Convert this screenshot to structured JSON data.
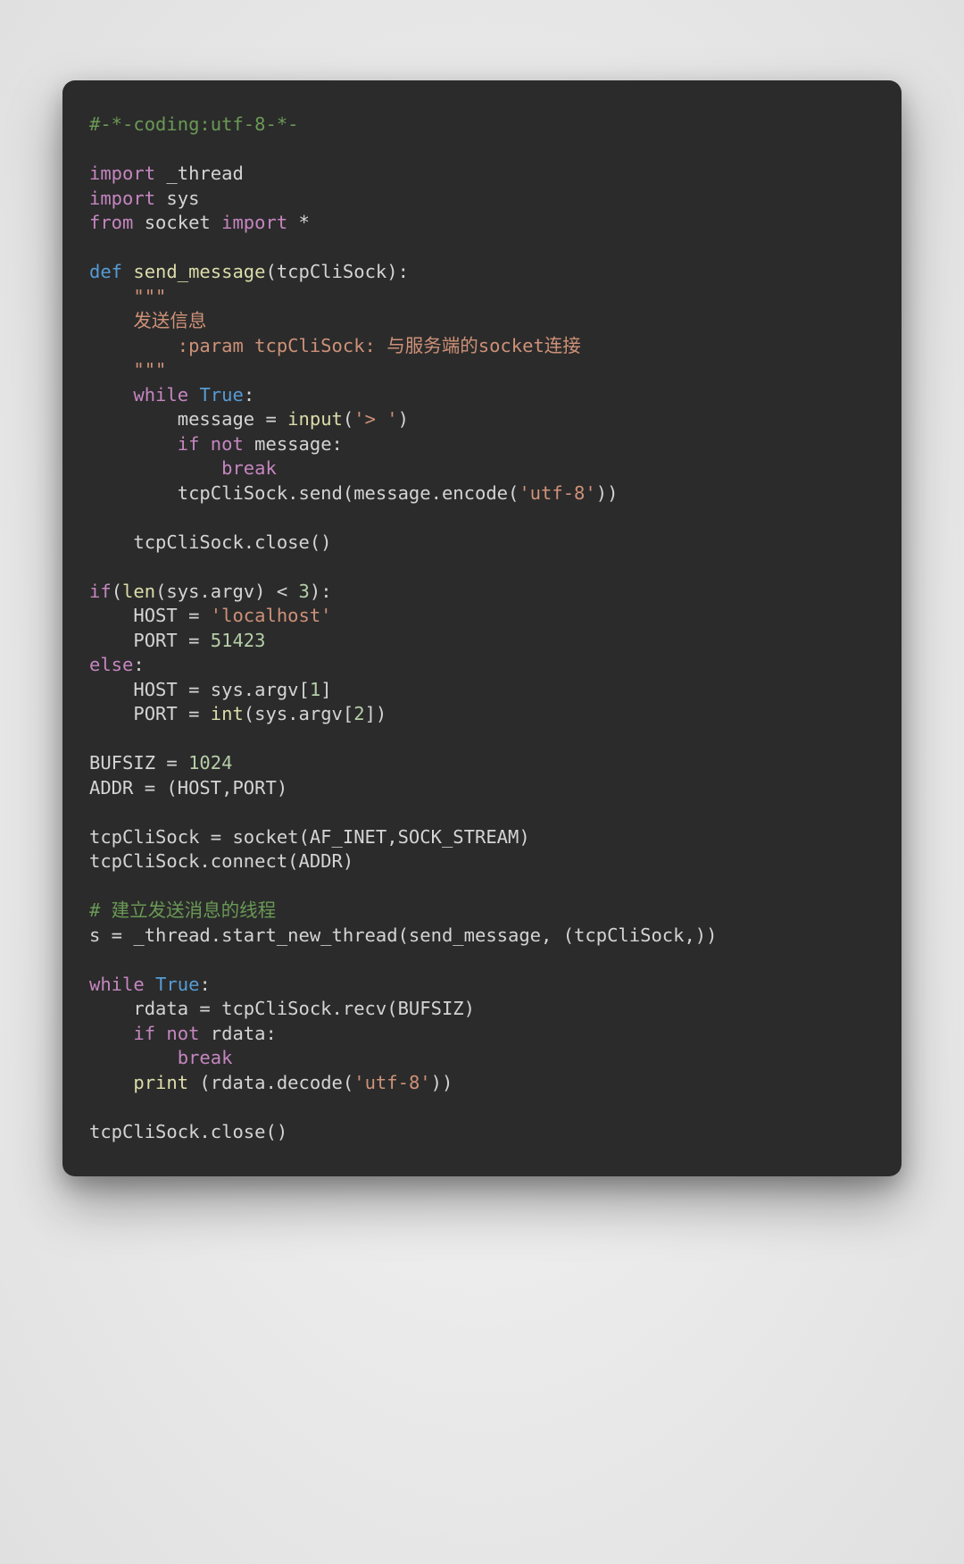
{
  "code": {
    "l1": "#-*-coding:utf-8-*-",
    "l2": "",
    "l3a": "import",
    "l3b": " _thread",
    "l4a": "import",
    "l4b": " sys",
    "l5a": "from",
    "l5b": " socket ",
    "l5c": "import",
    "l5d": " *",
    "l6": "",
    "l7a": "def",
    "l7b": " ",
    "l7c": "send_message",
    "l7d": "(tcpCliSock):",
    "l8": "    \"\"\"",
    "l9": "    发送信息",
    "l10": "        :param tcpCliSock: 与服务端的socket连接",
    "l11": "    \"\"\"",
    "l12a": "    ",
    "l12b": "while",
    "l12c": " ",
    "l12d": "True",
    "l12e": ":",
    "l13a": "        message = ",
    "l13b": "input",
    "l13c": "(",
    "l13d": "'> '",
    "l13e": ")",
    "l14a": "        ",
    "l14b": "if",
    "l14c": " ",
    "l14d": "not",
    "l14e": " message:",
    "l15a": "            ",
    "l15b": "break",
    "l16a": "        tcpCliSock.send(message.encode(",
    "l16b": "'utf-8'",
    "l16c": "))",
    "l17": "",
    "l18": "    tcpCliSock.close()",
    "l19": "",
    "l20a": "if",
    "l20b": "(",
    "l20c": "len",
    "l20d": "(sys.argv) < ",
    "l20e": "3",
    "l20f": "):",
    "l21a": "    HOST = ",
    "l21b": "'localhost'",
    "l22a": "    PORT = ",
    "l22b": "51423",
    "l23a": "else",
    "l23b": ":",
    "l24a": "    HOST = sys.argv[",
    "l24b": "1",
    "l24c": "]",
    "l25a": "    PORT = ",
    "l25b": "int",
    "l25c": "(sys.argv[",
    "l25d": "2",
    "l25e": "])",
    "l26": "",
    "l27a": "BUFSIZ = ",
    "l27b": "1024",
    "l28": "ADDR = (HOST,PORT)",
    "l29": "",
    "l30": "tcpCliSock = socket(AF_INET,SOCK_STREAM)",
    "l31": "tcpCliSock.connect(ADDR)",
    "l32": "",
    "l33": "# 建立发送消息的线程",
    "l34": "s = _thread.start_new_thread(send_message, (tcpCliSock,))",
    "l35": "",
    "l36a": "while",
    "l36b": " ",
    "l36c": "True",
    "l36d": ":",
    "l37": "    rdata = tcpCliSock.recv(BUFSIZ)",
    "l38a": "    ",
    "l38b": "if",
    "l38c": " ",
    "l38d": "not",
    "l38e": " rdata:",
    "l39a": "        ",
    "l39b": "break",
    "l40a": "    ",
    "l40b": "print",
    "l40c": " (rdata.decode(",
    "l40d": "'utf-8'",
    "l40e": "))",
    "l41": "",
    "l42": "tcpCliSock.close()"
  }
}
